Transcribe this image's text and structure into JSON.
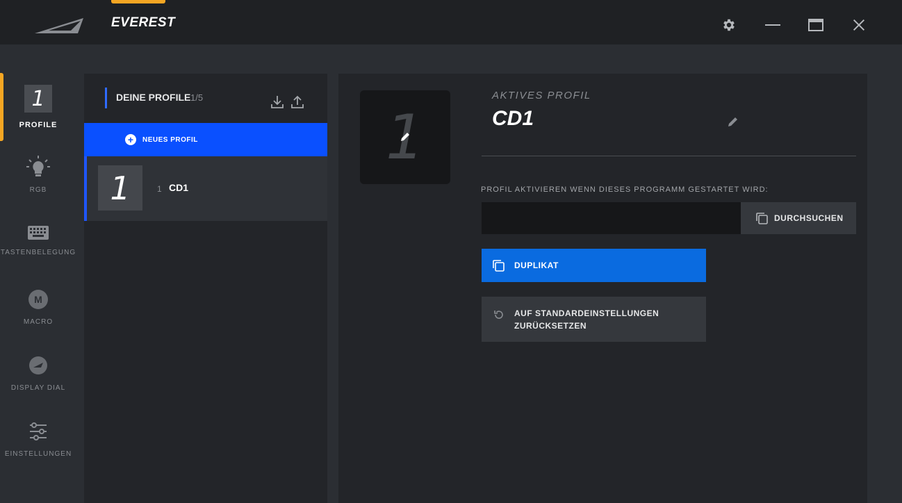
{
  "app": {
    "title": "EVEREST",
    "colors": {
      "accent": "#f5a623",
      "primary_blue": "#0a50ff",
      "button_blue": "#0a6be0"
    }
  },
  "window_controls": {
    "settings_icon": "gear-icon",
    "minimize_icon": "minimize-icon",
    "maximize_icon": "maximize-icon",
    "close_icon": "close-icon"
  },
  "nav": {
    "items": [
      {
        "label": "PROFILE",
        "icon": "profile-number-icon",
        "badge": "1",
        "active": true
      },
      {
        "label": "RGB",
        "icon": "lightbulb-icon"
      },
      {
        "label": "TASTENBELEGUNG",
        "icon": "keyboard-icon"
      },
      {
        "label": "MACRO",
        "icon": "macro-icon",
        "glyph": "M"
      },
      {
        "label": "DISPLAY DIAL",
        "icon": "display-dial-icon"
      },
      {
        "label": "EINSTELLUNGEN",
        "icon": "sliders-icon"
      }
    ]
  },
  "profiles": {
    "header_title": "DEINE PROFILE",
    "count": "1/5",
    "new_profile_label": "NEUES PROFIL",
    "items": [
      {
        "thumb": "1",
        "index": "1",
        "name": "CD1"
      }
    ]
  },
  "main": {
    "thumb_number": "1",
    "active_label": "AKTIVES PROFIL",
    "active_name": "CD1",
    "activate_label": "PROFIL AKTIVIEREN WENN DIESES PROGRAMM GESTARTET WIRD:",
    "program_value": "",
    "browse_label": "DURCHSUCHEN",
    "duplicate_label": "DUPLIKAT",
    "reset_label": "AUF STANDARDEINSTELLUNGEN ZURÜCKSETZEN"
  }
}
